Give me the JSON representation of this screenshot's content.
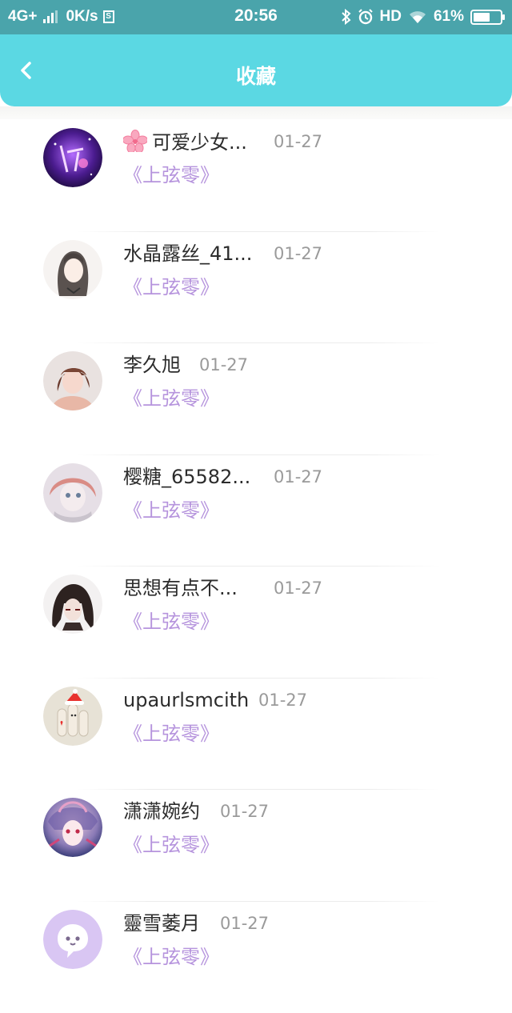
{
  "status_bar": {
    "network": "4G+",
    "speed": "0K/s",
    "sim_badge": "S",
    "time": "20:56",
    "hd": "HD",
    "battery": "61%",
    "battery_level": 0.61
  },
  "header": {
    "title": "收藏",
    "background": "#5bd8e3"
  },
  "list": [
    {
      "name": "可爱少女...",
      "prefix_icon": "cherry-blossom-icon",
      "date": "01-27",
      "work": "《上弦零》",
      "avatar": "purple-galaxy-avatar"
    },
    {
      "name": "水晶露丝_41...",
      "date": "01-27",
      "work": "《上弦零》",
      "avatar": "sketch-girl-avatar"
    },
    {
      "name": "李久旭",
      "date": "01-27",
      "work": "《上弦零》",
      "avatar": "photo-girl-avatar"
    },
    {
      "name": "樱糖_65582...",
      "date": "01-27",
      "work": "《上弦零》",
      "avatar": "anime-girl-avatar"
    },
    {
      "name": "思想有点不...",
      "date": "01-27",
      "work": "《上弦零》",
      "avatar": "dark-hair-avatar"
    },
    {
      "name": "upaurlsmcith",
      "date": "01-27",
      "work": "《上弦零》",
      "avatar": "christmas-fingers-avatar"
    },
    {
      "name": "潇潇婉约",
      "date": "01-27",
      "work": "《上弦零》",
      "avatar": "colorful-anime-avatar"
    },
    {
      "name": "靈雪萎月",
      "date": "01-27",
      "work": "《上弦零》",
      "avatar": "default-chat-avatar"
    }
  ],
  "colors": {
    "work_title": "#b694dd",
    "name": "#2c2c2c",
    "date": "#9a9a9a"
  }
}
